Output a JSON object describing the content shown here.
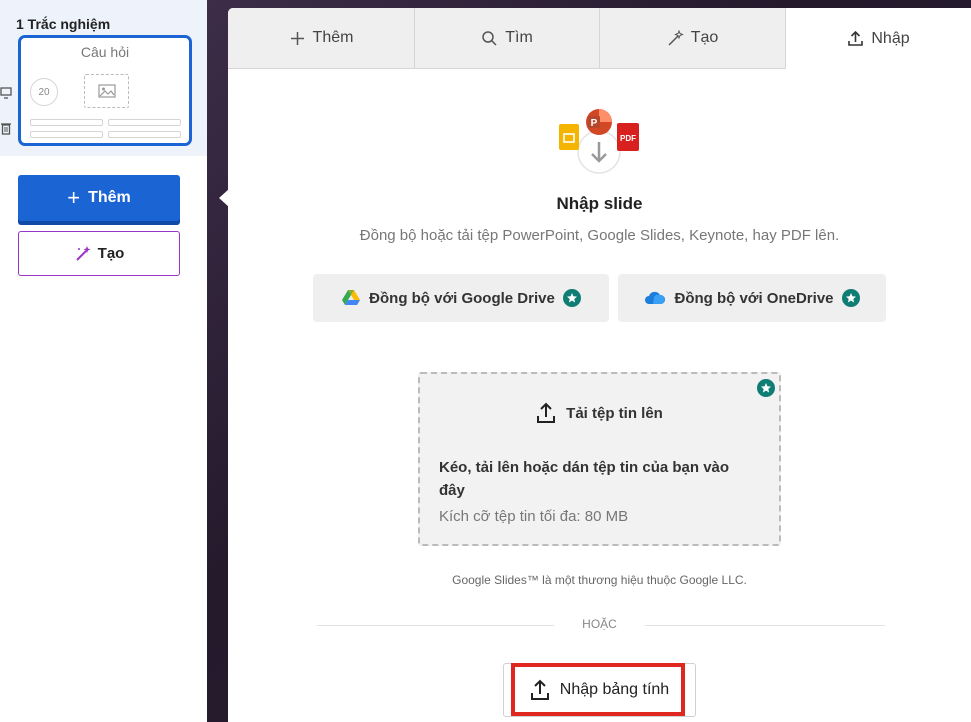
{
  "sidebar": {
    "slide_label": "1  Trắc nghiệm",
    "thumbnail": {
      "title": "Câu hỏi",
      "timer": "20"
    },
    "add_button": "Thêm",
    "generate_button": "Tạo"
  },
  "tabs": [
    {
      "label": "Thêm",
      "icon": "plus-icon"
    },
    {
      "label": "Tìm",
      "icon": "search-icon"
    },
    {
      "label": "Tạo",
      "icon": "magic-wand-icon"
    },
    {
      "label": "Nhập",
      "icon": "upload-icon"
    }
  ],
  "active_tab": "Nhập",
  "import": {
    "title": "Nhập slide",
    "subtitle": "Đồng bộ hoặc tải tệp PowerPoint, Google Slides, Keynote, hay PDF lên.",
    "google_drive_button": "Đồng bộ với Google Drive",
    "onedrive_button": "Đồng bộ với OneDrive",
    "upload_label": "Tải tệp tin lên",
    "drop_text": "Kéo, tải lên hoặc dán tệp tin của bạn vào đây",
    "size_limit": "Kích cỡ tệp tin tối đa: 80 MB",
    "trademark": "Google Slides™ là một thương hiệu thuộc Google LLC.",
    "or_label": "HOẶC",
    "spreadsheet_button": "Nhập bảng tính"
  },
  "hero_icon_labels": {
    "powerpoint": "P",
    "pdf": "PDF"
  },
  "colors": {
    "primary": "#1a64d4",
    "generate_border": "#9b34c9",
    "premium_badge": "#0f7d74",
    "highlight": "#e0271f"
  }
}
